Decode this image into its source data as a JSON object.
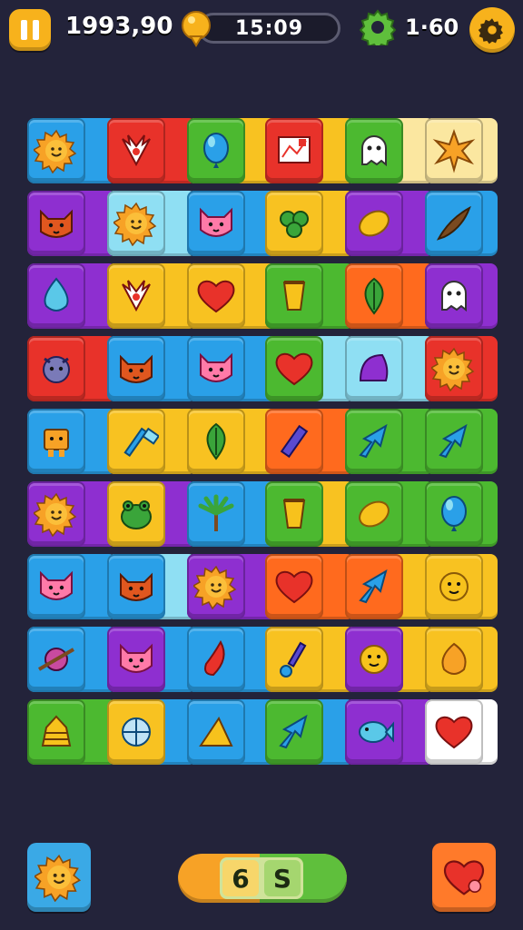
{
  "hud": {
    "score": "1993,90",
    "timer": "15:09",
    "gear_count": "1·60"
  },
  "bottom": {
    "counter_a": "6",
    "counter_b": "S"
  },
  "board": {
    "rows": [
      [
        {
          "c": "#2aa0e8",
          "i": "sun"
        },
        {
          "c": "#e8322a",
          "i": "wings"
        },
        {
          "c": "#4cb930",
          "i": "balloon"
        },
        {
          "c": "#e8322a",
          "i": "board"
        },
        {
          "c": "#4cb930",
          "i": "ghost"
        },
        {
          "c": "#fbe7a0",
          "i": "star"
        }
      ],
      [
        {
          "c": "#8e2fd0",
          "i": "fox"
        },
        {
          "c": "#8fdff3",
          "i": "sun"
        },
        {
          "c": "#2aa0e8",
          "i": "cat"
        },
        {
          "c": "#f8c221",
          "i": "clover"
        },
        {
          "c": "#8e2fd0",
          "i": "lemon"
        },
        {
          "c": "#2aa0e8",
          "i": "feather"
        }
      ],
      [
        {
          "c": "#8e2fd0",
          "i": "drop"
        },
        {
          "c": "#f8c221",
          "i": "wings"
        },
        {
          "c": "#f8c221",
          "i": "heart"
        },
        {
          "c": "#4cb930",
          "i": "cup"
        },
        {
          "c": "#ff6a1e",
          "i": "leaf"
        },
        {
          "c": "#8e2fd0",
          "i": "ghost"
        }
      ],
      [
        {
          "c": "#e8322a",
          "i": "monster"
        },
        {
          "c": "#2aa0e8",
          "i": "fox"
        },
        {
          "c": "#2aa0e8",
          "i": "cat"
        },
        {
          "c": "#4cb930",
          "i": "heart"
        },
        {
          "c": "#8fdff3",
          "i": "shell"
        },
        {
          "c": "#e8322a",
          "i": "sun"
        }
      ],
      [
        {
          "c": "#2aa0e8",
          "i": "robot"
        },
        {
          "c": "#f8c221",
          "i": "hammer"
        },
        {
          "c": "#f8c221",
          "i": "leaf"
        },
        {
          "c": "#ff6a1e",
          "i": "crayon"
        },
        {
          "c": "#4cb930",
          "i": "arrow"
        },
        {
          "c": "#4cb930",
          "i": "arrow"
        }
      ],
      [
        {
          "c": "#8e2fd0",
          "i": "sun"
        },
        {
          "c": "#f8c221",
          "i": "frog"
        },
        {
          "c": "#2aa0e8",
          "i": "palm"
        },
        {
          "c": "#4cb930",
          "i": "cup"
        },
        {
          "c": "#4cb930",
          "i": "lemon"
        },
        {
          "c": "#4cb930",
          "i": "balloon"
        }
      ],
      [
        {
          "c": "#2aa0e8",
          "i": "cat"
        },
        {
          "c": "#2aa0e8",
          "i": "fox"
        },
        {
          "c": "#8e2fd0",
          "i": "sun"
        },
        {
          "c": "#ff6a1e",
          "i": "heart"
        },
        {
          "c": "#ff6a1e",
          "i": "arrow"
        },
        {
          "c": "#f8c221",
          "i": "face"
        }
      ],
      [
        {
          "c": "#2aa0e8",
          "i": "planet"
        },
        {
          "c": "#8e2fd0",
          "i": "cat"
        },
        {
          "c": "#2aa0e8",
          "i": "chili"
        },
        {
          "c": "#f8c221",
          "i": "brush"
        },
        {
          "c": "#8e2fd0",
          "i": "face"
        },
        {
          "c": "#f8c221",
          "i": "mango"
        }
      ],
      [
        {
          "c": "#4cb930",
          "i": "hive"
        },
        {
          "c": "#f8c221",
          "i": "ball"
        },
        {
          "c": "#2aa0e8",
          "i": "cheese"
        },
        {
          "c": "#4cb930",
          "i": "arrow"
        },
        {
          "c": "#8e2fd0",
          "i": "fish"
        },
        {
          "c": "#ffffff",
          "i": "heart"
        }
      ]
    ],
    "segments": [
      [
        "#2aa0e8",
        "#e8322a",
        "#f8c221",
        "#f8c221",
        "#fbe7a0",
        "#fbe7a0"
      ],
      [
        "#8e2fd0",
        "#8fdff3",
        "#2aa0e8",
        "#f8c221",
        "#8e2fd0",
        "#2aa0e8"
      ],
      [
        "#8e2fd0",
        "#f8c221",
        "#f8c221",
        "#4cb930",
        "#ff6a1e",
        "#8e2fd0"
      ],
      [
        "#e8322a",
        "#2aa0e8",
        "#2aa0e8",
        "#8fdff3",
        "#8fdff3",
        "#e8322a"
      ],
      [
        "#2aa0e8",
        "#f8c221",
        "#f8c221",
        "#ff6a1e",
        "#4cb930",
        "#4cb930"
      ],
      [
        "#8e2fd0",
        "#8e2fd0",
        "#2aa0e8",
        "#f8c221",
        "#4cb930",
        "#4cb930"
      ],
      [
        "#2aa0e8",
        "#8fdff3",
        "#8e2fd0",
        "#ff6a1e",
        "#f8c221",
        "#f8c221"
      ],
      [
        "#2aa0e8",
        "#2aa0e8",
        "#2aa0e8",
        "#f8c221",
        "#f8c221",
        "#f8c221"
      ],
      [
        "#4cb930",
        "#2aa0e8",
        "#2aa0e8",
        "#2aa0e8",
        "#8e2fd0",
        "#ffffff"
      ]
    ]
  }
}
